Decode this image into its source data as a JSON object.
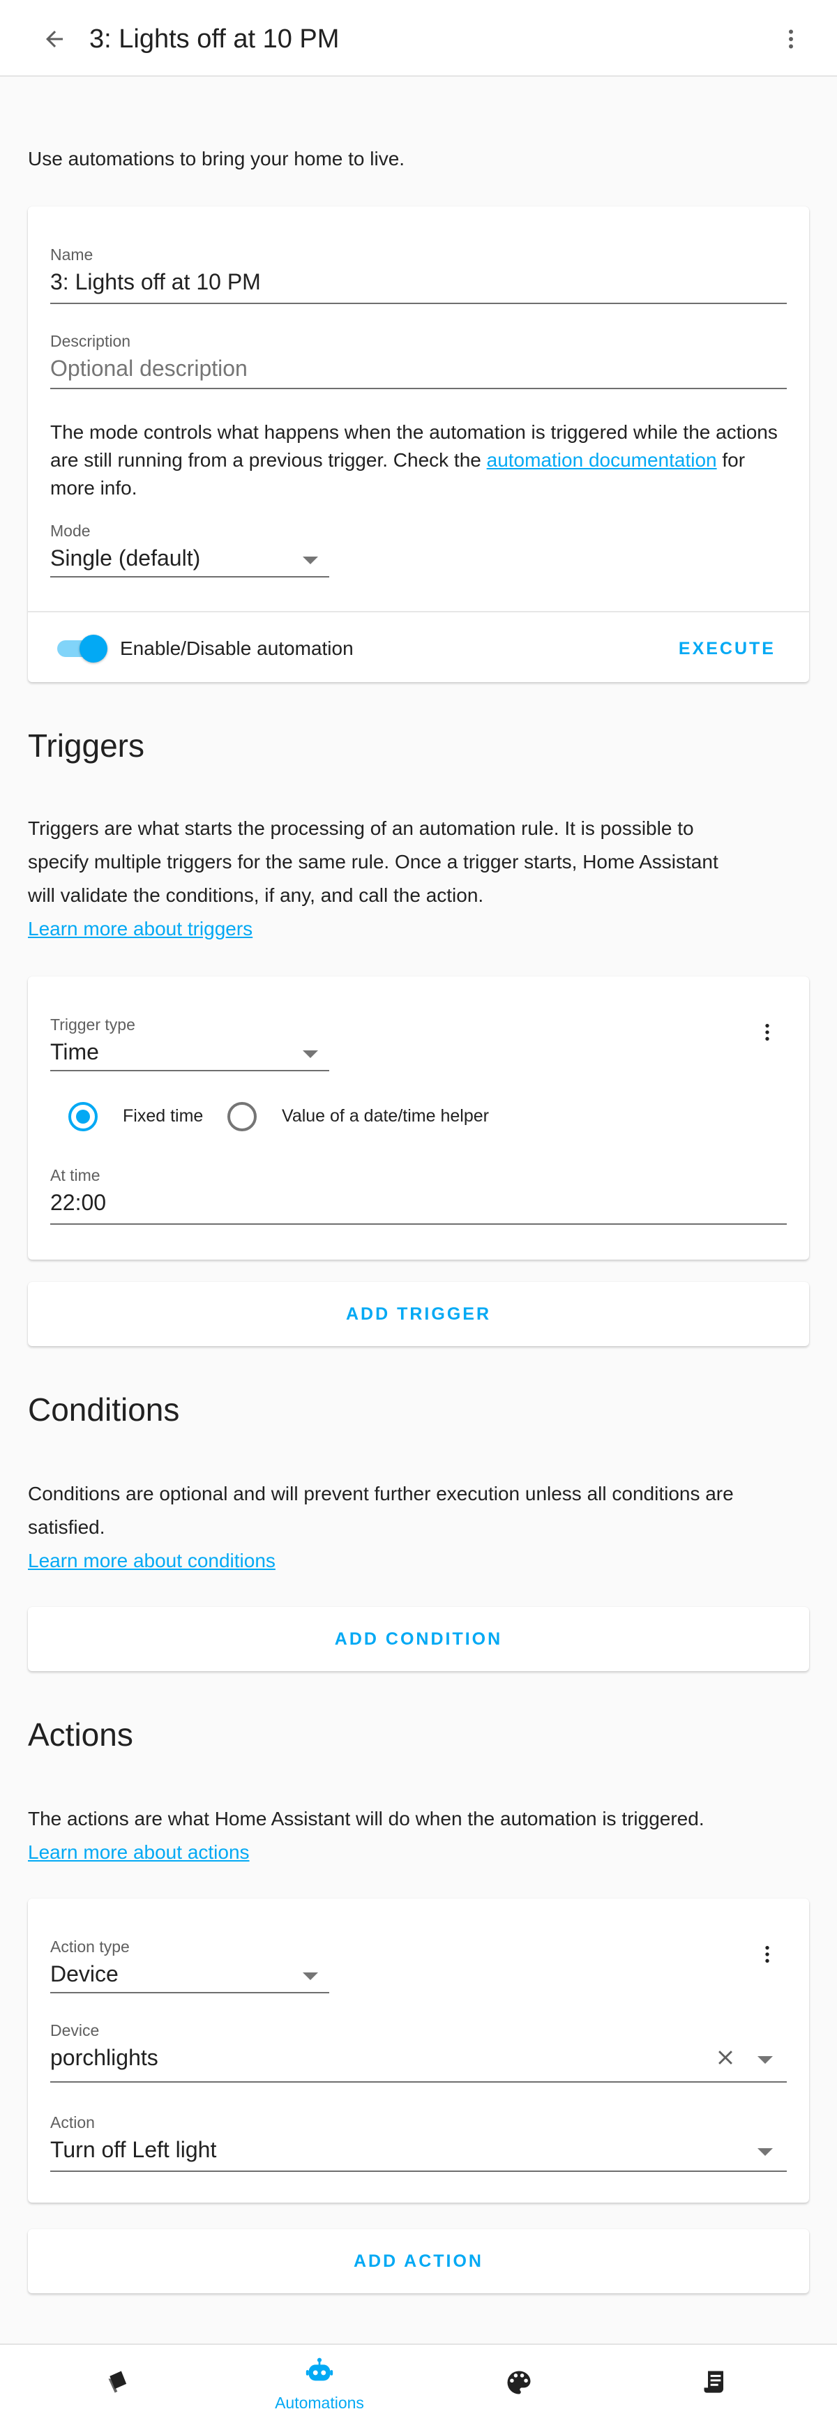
{
  "header": {
    "title": "3: Lights off at 10 PM"
  },
  "intro": "Use automations to bring your home to live.",
  "details": {
    "name_label": "Name",
    "name_value": "3: Lights off at 10 PM",
    "description_label": "Description",
    "description_placeholder": "Optional description",
    "mode_help_before": "The mode controls what happens when the automation is triggered while the actions are still running from a previous trigger. Check the ",
    "mode_help_link": "automation documentation",
    "mode_help_after": " for more info.",
    "mode_label": "Mode",
    "mode_value": "Single (default)",
    "enable_label": "Enable/Disable automation",
    "enable_state": true,
    "execute_label": "EXECUTE"
  },
  "triggers": {
    "title": "Triggers",
    "description": "Triggers are what starts the processing of an automation rule. It is possible to specify multiple triggers for the same rule. Once a trigger starts, Home Assistant will validate the conditions, if any, and call the action.",
    "learn_more": "Learn more about triggers",
    "card": {
      "type_label": "Trigger type",
      "type_value": "Time",
      "radio_fixed": "Fixed time",
      "radio_helper": "Value of a date/time helper",
      "selected": "Fixed time",
      "at_time_label": "At time",
      "at_time_value": "22:00"
    },
    "add_label": "ADD TRIGGER"
  },
  "conditions": {
    "title": "Conditions",
    "description": "Conditions are optional and will prevent further execution unless all conditions are satisfied.",
    "learn_more": "Learn more about conditions",
    "add_label": "ADD CONDITION"
  },
  "actions": {
    "title": "Actions",
    "description": "The actions are what Home Assistant will do when the automation is triggered.",
    "learn_more": "Learn more about actions",
    "card": {
      "type_label": "Action type",
      "type_value": "Device",
      "device_label": "Device",
      "device_value": "porchlights",
      "action_label": "Action",
      "action_value": "Turn off Left light"
    },
    "add_label": "ADD ACTION"
  },
  "bottom_nav": {
    "items": [
      {
        "icon": "cards-icon",
        "label": ""
      },
      {
        "icon": "robot-icon",
        "label": "Automations",
        "active": true
      },
      {
        "icon": "palette-icon",
        "label": ""
      },
      {
        "icon": "script-icon",
        "label": ""
      }
    ]
  },
  "colors": {
    "accent": "#03a9f4",
    "text": "#212121",
    "secondary": "#757575",
    "background": "#fafafa"
  }
}
